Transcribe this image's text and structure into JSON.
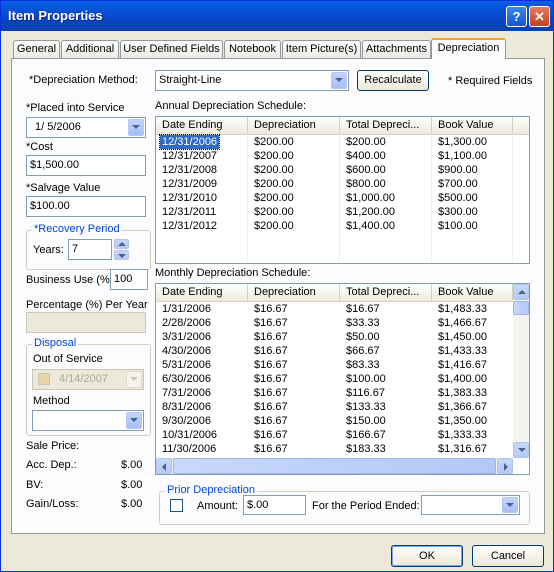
{
  "window": {
    "title": "Item Properties",
    "help_label": "?",
    "close_label": "✕"
  },
  "tabs": [
    {
      "label": "General"
    },
    {
      "label": "Additional"
    },
    {
      "label": "User Defined Fields"
    },
    {
      "label": "Notebook"
    },
    {
      "label": "Item Picture(s)"
    },
    {
      "label": "Attachments"
    },
    {
      "label": "Depreciation"
    }
  ],
  "depreciation": {
    "method_label": "*Depreciation Method:",
    "method_value": "Straight-Line",
    "recalculate_label": "Recalculate",
    "required_note": "* Required Fields"
  },
  "left": {
    "placed_label": "*Placed into Service",
    "placed_value": "1/ 5/2006",
    "cost_label": "*Cost",
    "cost_value": "$1,500.00",
    "salvage_label": "*Salvage Value",
    "salvage_value": "$100.00",
    "recovery_title": "*Recovery Period",
    "years_label": "Years:",
    "years_value": "7",
    "business_use_label": "Business Use (%)",
    "business_use_value": "100",
    "pct_per_year_label": "Percentage (%) Per Year",
    "pct_per_year_value": "",
    "disposal_title": "Disposal",
    "out_of_service_label": "Out of Service",
    "out_of_service_value": "4/14/2007",
    "method_label": "Method",
    "method_value": "",
    "sale_price_label": "Sale Price:",
    "acc_dep_label": "Acc. Dep.:",
    "acc_dep_value": "$.00",
    "bv_label": "BV:",
    "bv_value": "$.00",
    "gain_loss_label": "Gain/Loss:",
    "gain_loss_value": "$.00"
  },
  "annual": {
    "title": "Annual Depreciation Schedule:",
    "columns": [
      "Date Ending",
      "Depreciation",
      "Total Depreci...",
      "Book Value"
    ],
    "rows": [
      [
        "12/31/2006",
        "$200.00",
        "$200.00",
        "$1,300.00"
      ],
      [
        "12/31/2007",
        "$200.00",
        "$400.00",
        "$1,100.00"
      ],
      [
        "12/31/2008",
        "$200.00",
        "$600.00",
        "$900.00"
      ],
      [
        "12/31/2009",
        "$200.00",
        "$800.00",
        "$700.00"
      ],
      [
        "12/31/2010",
        "$200.00",
        "$1,000.00",
        "$500.00"
      ],
      [
        "12/31/2011",
        "$200.00",
        "$1,200.00",
        "$300.00"
      ],
      [
        "12/31/2012",
        "$200.00",
        "$1,400.00",
        "$100.00"
      ]
    ]
  },
  "monthly": {
    "title": "Monthly Depreciation Schedule:",
    "columns": [
      "Date Ending",
      "Depreciation",
      "Total Depreci...",
      "Book Value"
    ],
    "rows": [
      [
        "1/31/2006",
        "$16.67",
        "$16.67",
        "$1,483.33"
      ],
      [
        "2/28/2006",
        "$16.67",
        "$33.33",
        "$1,466.67"
      ],
      [
        "3/31/2006",
        "$16.67",
        "$50.00",
        "$1,450.00"
      ],
      [
        "4/30/2006",
        "$16.67",
        "$66.67",
        "$1,433.33"
      ],
      [
        "5/31/2006",
        "$16.67",
        "$83.33",
        "$1,416.67"
      ],
      [
        "6/30/2006",
        "$16.67",
        "$100.00",
        "$1,400.00"
      ],
      [
        "7/31/2006",
        "$16.67",
        "$116.67",
        "$1,383.33"
      ],
      [
        "8/31/2006",
        "$16.67",
        "$133.33",
        "$1,366.67"
      ],
      [
        "9/30/2006",
        "$16.67",
        "$150.00",
        "$1,350.00"
      ],
      [
        "10/31/2006",
        "$16.67",
        "$166.67",
        "$1,333.33"
      ],
      [
        "11/30/2006",
        "$16.67",
        "$183.33",
        "$1,316.67"
      ]
    ]
  },
  "prior": {
    "title": "Prior Depreciation",
    "amount_label": "Amount:",
    "amount_value": "$.00",
    "period_label": "For the Period Ended:",
    "period_value": ""
  },
  "footer": {
    "ok_label": "OK",
    "cancel_label": "Cancel"
  }
}
